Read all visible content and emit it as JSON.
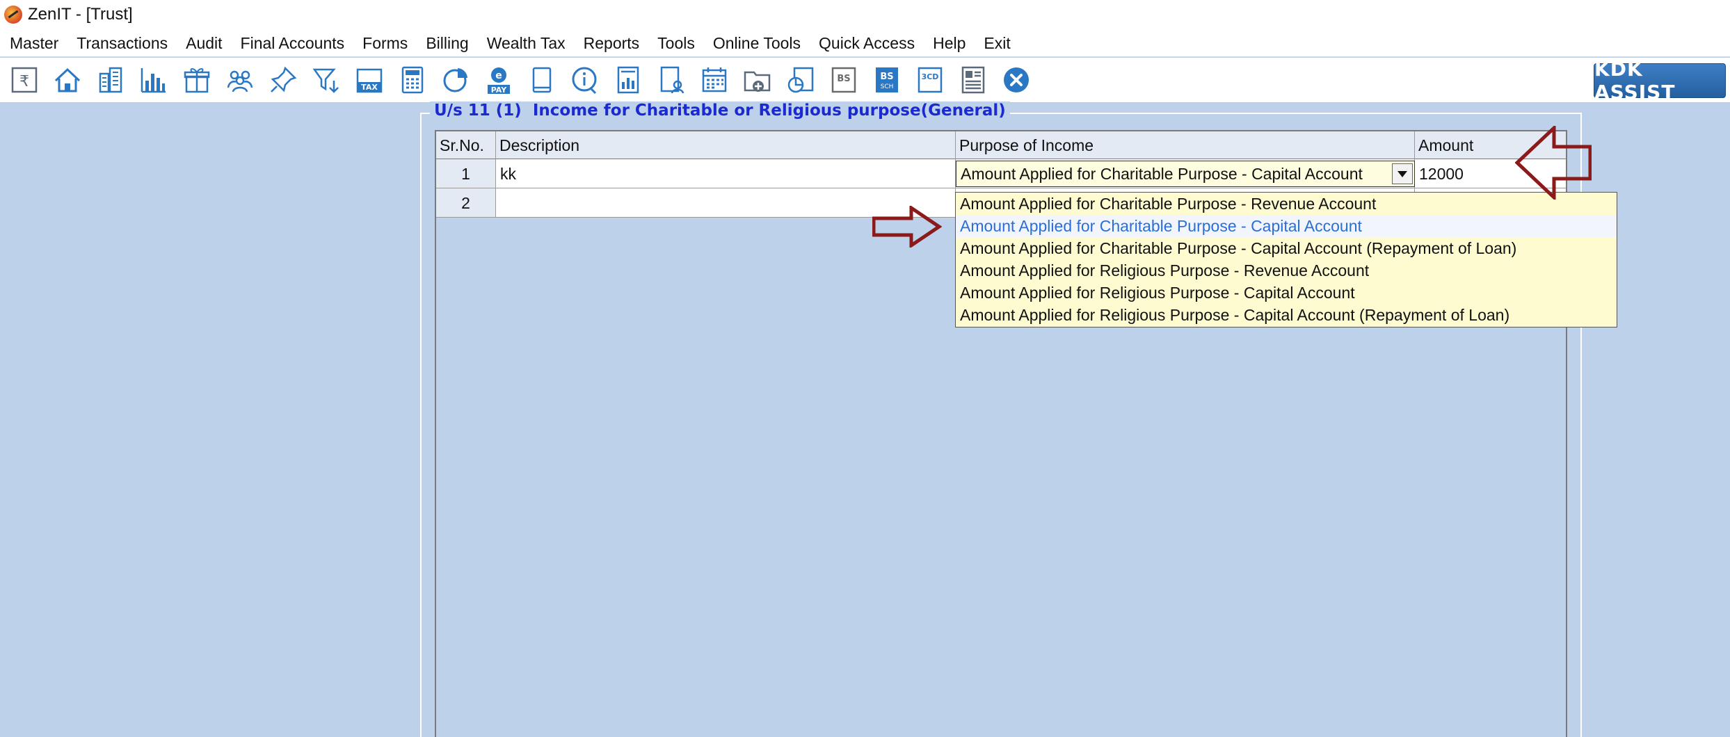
{
  "window": {
    "title": "ZenIT - [Trust]"
  },
  "menu": [
    "Master",
    "Transactions",
    "Audit",
    "Final Accounts",
    "Forms",
    "Billing",
    "Wealth Tax",
    "Reports",
    "Tools",
    "Online Tools",
    "Quick Access",
    "Help",
    "Exit"
  ],
  "toolbar": {
    "icons": [
      "rupee-ledger-icon",
      "home-icon",
      "buildings-icon",
      "bar-chart-icon",
      "gift-icon",
      "users-group-icon",
      "pin-icon",
      "filter-icon",
      "tax-icon",
      "calculator-icon",
      "pie-chart-icon",
      "epay-icon",
      "book-icon",
      "info-icon",
      "report-icon",
      "user-document-icon",
      "calendar-icon",
      "folder-add-icon",
      "chart-document-icon",
      "bs-icon",
      "bs-sch-icon",
      "3cd-icon",
      "form-icon",
      "close-icon"
    ],
    "tax_label": "TAX",
    "pay_label": "PAY",
    "bs_label": "BS",
    "sch_label": "SCH",
    "cd_label": "3CD",
    "kdk_label": "KDK ASSIST",
    "accent_color": "#2a77c4"
  },
  "panel": {
    "title": "U/s 11 (1)  Income for Charitable or Religious purpose(General)",
    "title_color": "#1a2ad0"
  },
  "grid": {
    "headers": {
      "sr": "Sr.No.",
      "description": "Description",
      "purpose": "Purpose of Income",
      "amount": "Amount"
    },
    "rows": [
      {
        "sr": "1",
        "description": "kk",
        "purpose": "Amount Applied for Charitable Purpose - Capital Account",
        "amount": "12000"
      },
      {
        "sr": "2",
        "description": "",
        "purpose": "",
        "amount": ""
      }
    ]
  },
  "dropdown": {
    "options": [
      "Amount Applied for Charitable Purpose - Revenue Account",
      "Amount Applied for Charitable Purpose - Capital Account",
      "Amount Applied for Charitable Purpose - Capital Account (Repayment of Loan)",
      "Amount Applied for Religious Purpose - Revenue Account",
      "Amount Applied for Religious Purpose - Capital Account",
      "Amount Applied for Religious Purpose - Capital Account (Repayment of Loan)"
    ],
    "selected_index": 1,
    "highlight_color": "#2b6fd6"
  },
  "annotations": {
    "arrow_color": "#8b1a1a"
  }
}
